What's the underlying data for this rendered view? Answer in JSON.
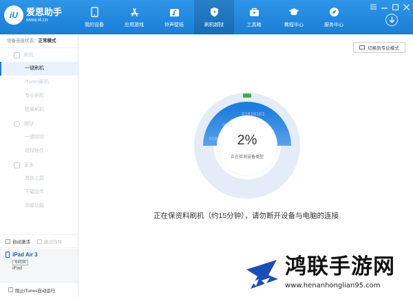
{
  "app": {
    "logo_badge": "iU",
    "name": "爱思助手",
    "url": "www.i4.cn"
  },
  "nav": [
    {
      "label": "我的设备",
      "icon": "phone-icon"
    },
    {
      "label": "应用游戏",
      "icon": "app-store-icon"
    },
    {
      "label": "铃声壁纸",
      "icon": "ringtone-wallpaper-icon"
    },
    {
      "label": "刷机越狱",
      "icon": "flash-jailbreak-icon",
      "active": true
    },
    {
      "label": "工具箱",
      "icon": "toolbox-icon"
    },
    {
      "label": "教程中心",
      "icon": "graduation-cap-icon"
    },
    {
      "label": "服务中心",
      "icon": "compass-icon"
    }
  ],
  "sidebar": {
    "status_label": "设备连接状态：",
    "status_value": "正常模式",
    "groups": [
      {
        "label": "刷机",
        "items": [
          "一键刷机",
          "iTunes刷机",
          "专业刷机",
          "批量刷机"
        ]
      },
      {
        "label": "越狱",
        "items": [
          "一键越狱",
          "越狱插件"
        ]
      },
      {
        "label": "更多",
        "items": [
          "其他工具",
          "下载固件",
          "高级功能"
        ]
      }
    ],
    "active_item": "一键刷机",
    "checkbox_auto_activate": "自动激活",
    "checkbox_skip_guide": "跳过向导",
    "device": {
      "name": "iPad Air 3",
      "capacity": "64GB",
      "type": "iPad"
    },
    "checkbox_block_itunes": "阻止iTunes自动运行"
  },
  "main": {
    "mode_button": "切换到专业模式",
    "progress_fraction": 0.02,
    "progress_text": "2%",
    "progress_status": "正在检测设备类型",
    "binary_text": "01010101",
    "notice": "正在保资料刷机（约15分钟），请勿断开设备与电脑的连接"
  },
  "watermark": {
    "title": "鸿联手游网",
    "url": "www.henanhonglian95.com"
  },
  "colors": {
    "accent": "#1a7fd6",
    "ring_light": "#e3ecf8",
    "ring_fill": "#2f86e0",
    "progress_marker": "#3cb043"
  }
}
